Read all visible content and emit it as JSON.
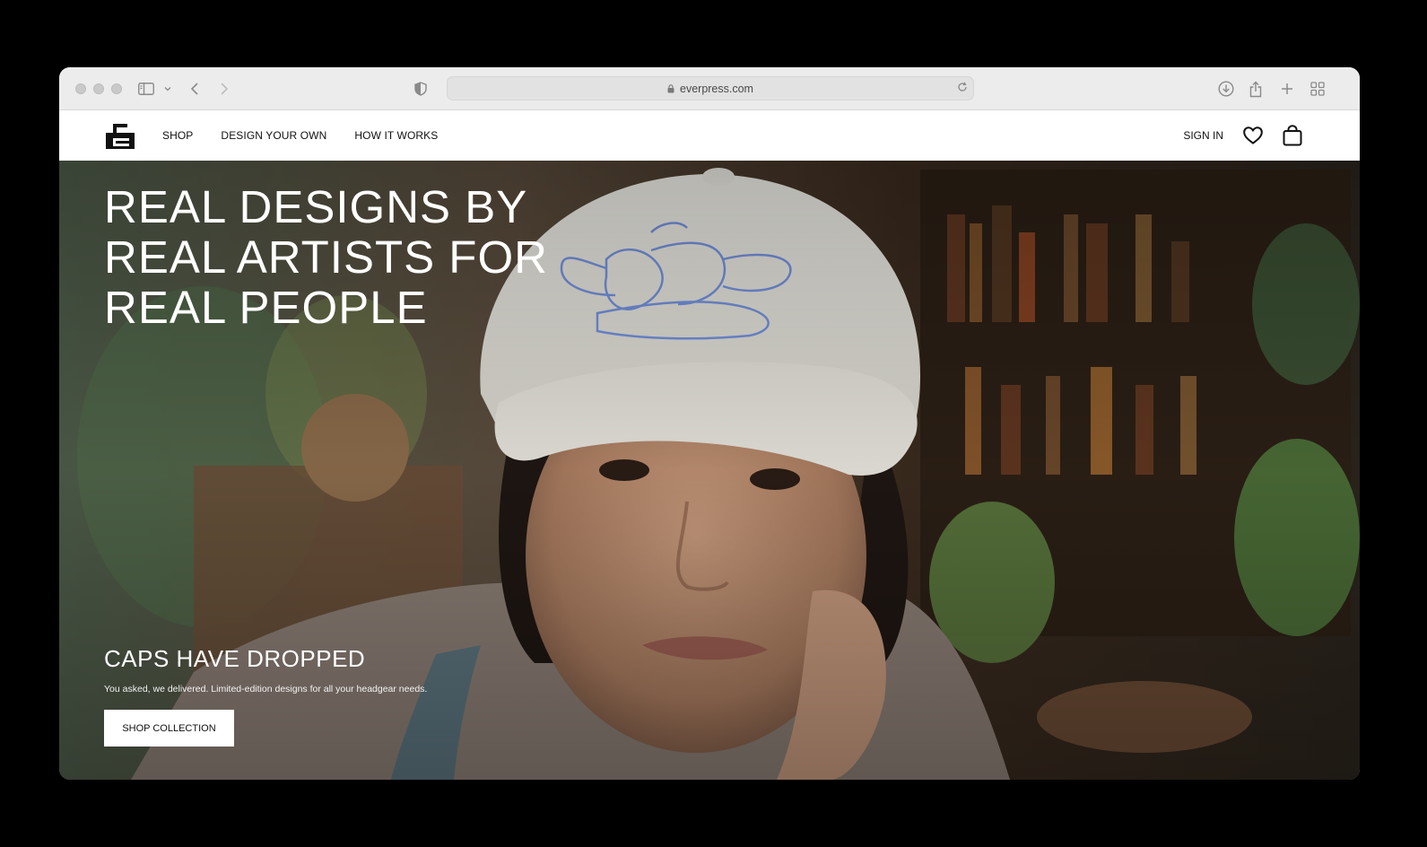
{
  "browser": {
    "url": "everpress.com"
  },
  "header": {
    "nav": [
      "SHOP",
      "DESIGN YOUR OWN",
      "HOW IT WORKS"
    ],
    "sign_in": "SIGN IN"
  },
  "hero": {
    "title": "REAL DESIGNS BY\nREAL ARTISTS FOR\nREAL PEOPLE",
    "promo_title": "CAPS HAVE DROPPED",
    "promo_subtitle": "You asked, we delivered. Limited-edition designs for all your headgear needs.",
    "cta_label": "SHOP COLLECTION"
  },
  "icons": {
    "toolbar": [
      "sidebar-icon",
      "chevron-down-icon",
      "back-icon",
      "forward-icon",
      "privacy-shield-icon",
      "lock-icon",
      "reload-icon",
      "download-icon",
      "share-icon",
      "new-tab-icon",
      "tab-overview-icon"
    ],
    "header": [
      "everpress-logo",
      "heart-icon",
      "bag-icon"
    ]
  },
  "colors": {
    "page_bg": "#000000",
    "toolbar_bg": "#ececec",
    "header_bg": "#ffffff",
    "hero_text": "#ffffff",
    "cap_embroidery": "#6f8fe0"
  }
}
